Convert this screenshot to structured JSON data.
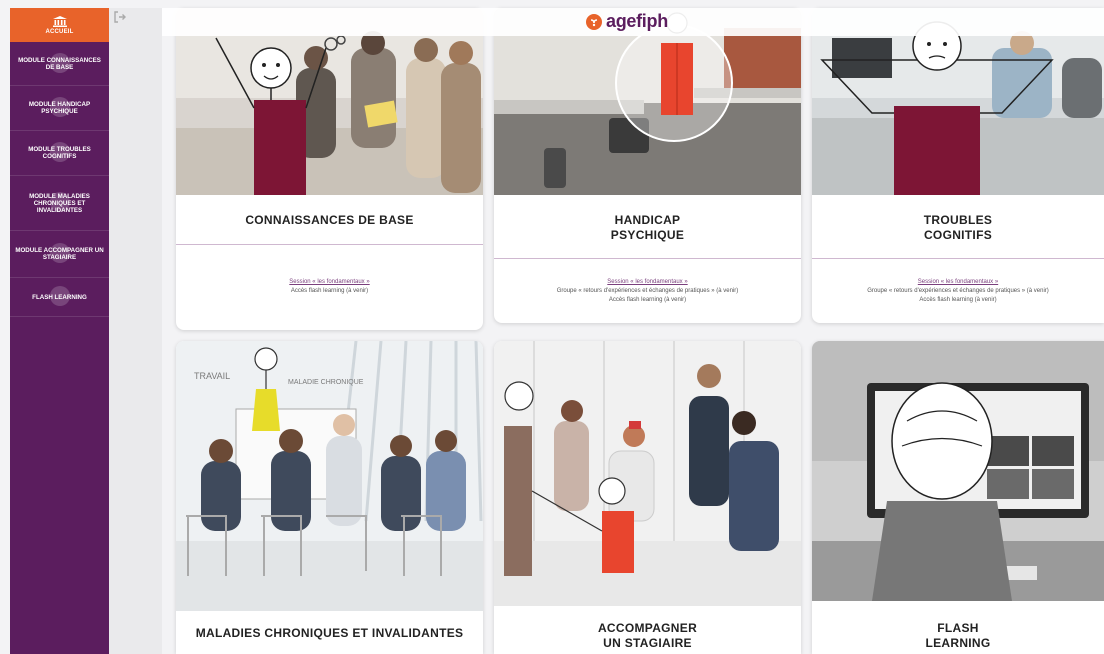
{
  "logo": {
    "text": "agefiph"
  },
  "sidebar": {
    "home_label": "ACCUEIL",
    "items": [
      {
        "label": "MODULE CONNAISSANCES DE BASE"
      },
      {
        "label": "MODULE HANDICAP PSYCHIQUE"
      },
      {
        "label": "MODULE TROUBLES COGNITIFS"
      },
      {
        "label": "MODULE MALADIES CHRONIQUES ET INVALIDANTES"
      },
      {
        "label": "MODULE ACCOMPAGNER UN STAGIAIRE"
      },
      {
        "label": "FLASH LEARNING"
      }
    ]
  },
  "cards": [
    {
      "title": "CONNAISSANCES DE BASE",
      "links": [
        "Session « les fondamentaux »"
      ],
      "notes": [
        "Accès flash learning (à venir)"
      ]
    },
    {
      "title_line1": "HANDICAP",
      "title_line2": "PSYCHIQUE",
      "links": [
        "Session « les fondamentaux »"
      ],
      "notes": [
        "Groupe « retours d'expériences et échanges de pratiques » (à venir)",
        "Accès flash learning (à venir)"
      ]
    },
    {
      "title_line1": "TROUBLES",
      "title_line2": "COGNITIFS",
      "links": [
        "Session « les fondamentaux »"
      ],
      "notes": [
        "Groupe « retours d'expériences et échanges de pratiques » (à venir)",
        "Accès flash learning (à venir)"
      ]
    },
    {
      "title": "MALADIES CHRONIQUES ET INVALIDANTES",
      "scribble": [
        "TRAVAIL",
        "MALADIE CHRONIQUE"
      ]
    },
    {
      "title_line1": "ACCOMPAGNER",
      "title_line2": "UN STAGIAIRE"
    },
    {
      "title_line1": "FLASH",
      "title_line2": "LEARNING"
    }
  ],
  "colors": {
    "sidebar": "#5b1d5e",
    "accent": "#e8632a",
    "burgundy": "#7d1535",
    "red": "#e8452e"
  }
}
